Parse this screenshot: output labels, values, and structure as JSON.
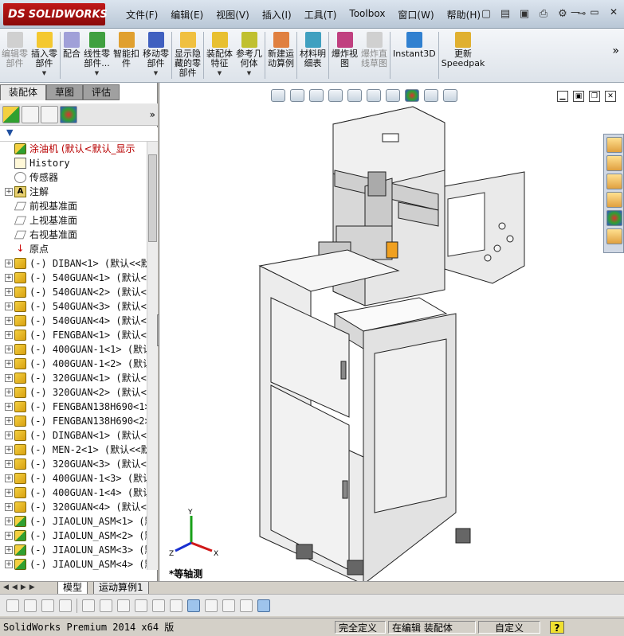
{
  "app": {
    "logo_text": "SOLIDWORKS",
    "logo_mark": "DS"
  },
  "menu": [
    "文件(F)",
    "编辑(E)",
    "视图(V)",
    "插入(I)",
    "工具(T)",
    "Toolbox",
    "窗口(W)",
    "帮助(H)"
  ],
  "quick_access": [
    "new-document-icon",
    "open-icon",
    "save-icon",
    "print-icon",
    "options-icon",
    "pin-icon"
  ],
  "window_controls": [
    "minimize",
    "restore",
    "close"
  ],
  "command_manager": [
    {
      "label": "编辑零\n部件",
      "icon": "edit-component-icon",
      "disabled": true
    },
    {
      "label": "插入零\n部件",
      "icon": "insert-component-icon",
      "disabled": false,
      "dropdown": true
    },
    {
      "label": "配合",
      "icon": "mate-icon",
      "disabled": false
    },
    {
      "label": "线性零\n部件...",
      "icon": "linear-pattern-icon",
      "disabled": false,
      "dropdown": true
    },
    {
      "label": "智能扣\n件",
      "icon": "smart-fasteners-icon",
      "disabled": false
    },
    {
      "label": "移动零\n部件",
      "icon": "move-component-icon",
      "disabled": false,
      "dropdown": true
    },
    {
      "label": "显示隐\n藏的零\n部件",
      "icon": "show-hidden-icon",
      "disabled": false
    },
    {
      "label": "装配体\n特征",
      "icon": "assembly-feature-icon",
      "disabled": false,
      "dropdown": true
    },
    {
      "label": "参考几\n何体",
      "icon": "reference-geometry-icon",
      "disabled": false,
      "dropdown": true
    },
    {
      "label": "新建运\n动算例",
      "icon": "new-motion-study-icon",
      "disabled": false
    },
    {
      "label": "材料明\n细表",
      "icon": "bom-icon",
      "disabled": false
    },
    {
      "label": "爆炸视\n图",
      "icon": "exploded-view-icon",
      "disabled": false
    },
    {
      "label": "爆炸直\n线草图",
      "icon": "explode-line-sketch-icon",
      "disabled": true
    },
    {
      "label": "Instant3D",
      "icon": "instant3d-icon",
      "disabled": false
    },
    {
      "label": "更新\nSpeedpak",
      "icon": "speedpak-icon",
      "disabled": false
    }
  ],
  "panel_tabs": [
    "装配体",
    "草图",
    "评估"
  ],
  "feature_tree": {
    "root": "涂油机 (默认<默认_显示",
    "fixed": [
      {
        "label": "History",
        "icon": "history",
        "mono": true
      },
      {
        "label": "传感器",
        "icon": "sensor"
      },
      {
        "label": "注解",
        "icon": "annotation",
        "exp": true
      },
      {
        "label": "前视基准面",
        "icon": "plane"
      },
      {
        "label": "上视基准面",
        "icon": "plane"
      },
      {
        "label": "右视基准面",
        "icon": "plane"
      },
      {
        "label": "原点",
        "icon": "origin"
      }
    ],
    "components": [
      {
        "label": "(-) DIBAN<1> (默认<<默认",
        "type": "part"
      },
      {
        "label": "(-) 540GUAN<1> (默认<<默",
        "type": "part"
      },
      {
        "label": "(-) 540GUAN<2> (默认<<默",
        "type": "part"
      },
      {
        "label": "(-) 540GUAN<3> (默认<<默",
        "type": "part"
      },
      {
        "label": "(-) 540GUAN<4> (默认<<默",
        "type": "part"
      },
      {
        "label": "(-) FENGBAN<1> (默认<<默",
        "type": "part"
      },
      {
        "label": "(-) 400GUAN-1<1> (默认<<",
        "type": "part"
      },
      {
        "label": "(-) 400GUAN-1<2> (默认<<",
        "type": "part"
      },
      {
        "label": "(-) 320GUAN<1> (默认<<默",
        "type": "part"
      },
      {
        "label": "(-) 320GUAN<2> (默认<<默",
        "type": "part"
      },
      {
        "label": "(-) FENGBAN138H690<1> (",
        "type": "part"
      },
      {
        "label": "(-) FENGBAN138H690<2> (",
        "type": "part"
      },
      {
        "label": "(-) DINGBAN<1> (默认<<默",
        "type": "part"
      },
      {
        "label": "(-) MEN-2<1> (默认<<默认",
        "type": "part"
      },
      {
        "label": "(-) 320GUAN<3> (默认<<默",
        "type": "part"
      },
      {
        "label": "(-) 400GUAN-1<3> (默认<<",
        "type": "part"
      },
      {
        "label": "(-) 400GUAN-1<4> (默认<<",
        "type": "part"
      },
      {
        "label": "(-) 320GUAN<4> (默认<<默",
        "type": "part"
      },
      {
        "label": "(-) JIAOLUN_ASM<1> (默认",
        "type": "asm"
      },
      {
        "label": "(-) JIAOLUN_ASM<2> (默认",
        "type": "asm"
      },
      {
        "label": "(-) JIAOLUN_ASM<3> (默认",
        "type": "asm"
      },
      {
        "label": "(-) JIAOLUN_ASM<4> (默认",
        "type": "asm"
      }
    ]
  },
  "viewport": {
    "view_label": "*等轴测",
    "triad_axes": [
      "X",
      "Y",
      "Z"
    ]
  },
  "bottom_tabs": [
    "模型",
    "运动算例1"
  ],
  "status": {
    "version": "SolidWorks Premium 2014 x64 版",
    "definition": "完全定义",
    "editing": "在编辑 装配体",
    "units": "自定义",
    "help": "?"
  }
}
